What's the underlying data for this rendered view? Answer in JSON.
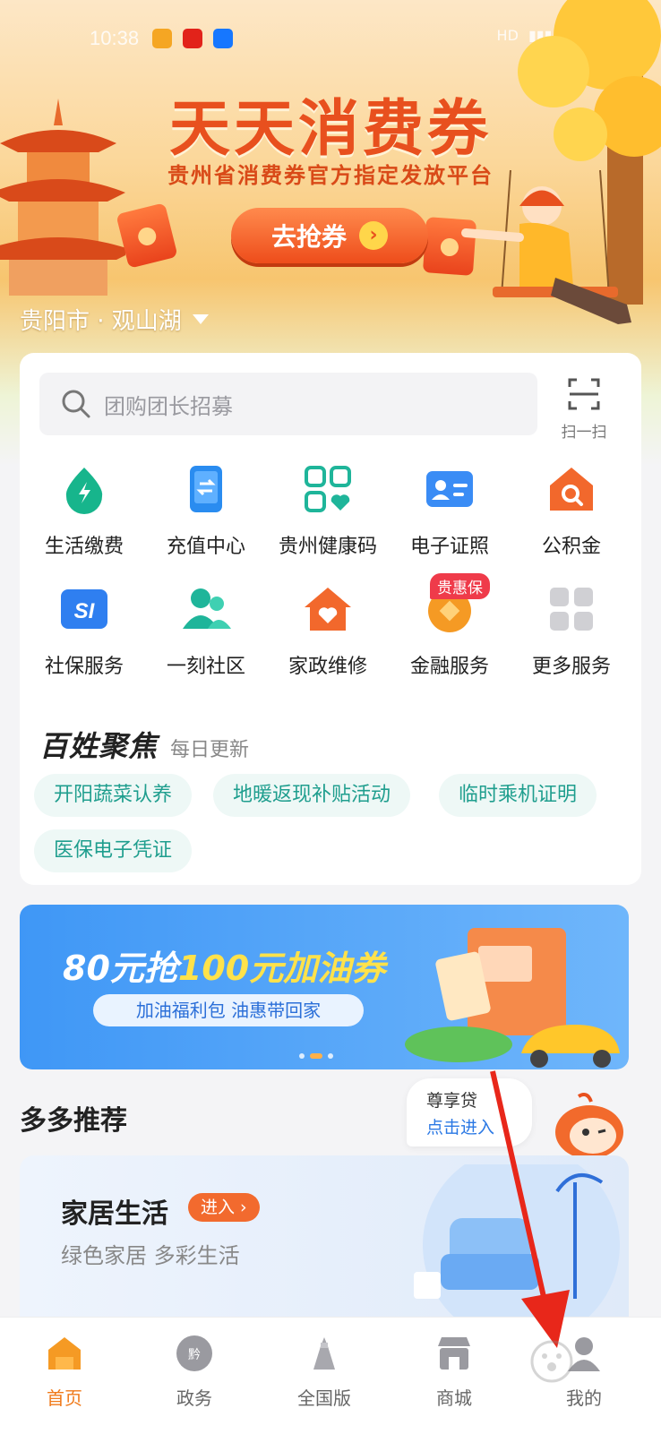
{
  "status_bar": {
    "time": "10:38",
    "network": "HD",
    "battery": "88"
  },
  "hero": {
    "title": "天天消费券",
    "subtitle": "贵州省消费券官方指定发放平台",
    "cta_label": "去抢券",
    "location": "贵阳市 · 观山湖"
  },
  "search": {
    "placeholder": "团购团长招募",
    "scan_label": "扫一扫"
  },
  "services": [
    {
      "label": "生活缴费",
      "icon": "bolt-drop-icon",
      "color": "#17b58c"
    },
    {
      "label": "充值中心",
      "icon": "phone-recharge-icon",
      "color": "#2a8cf0"
    },
    {
      "label": "贵州健康码",
      "icon": "health-code-icon",
      "color": "#1fb59a"
    },
    {
      "label": "电子证照",
      "icon": "id-card-icon",
      "color": "#3a8cf5"
    },
    {
      "label": "公积金",
      "icon": "house-search-icon",
      "color": "#f2682c"
    },
    {
      "label": "社保服务",
      "icon": "social-security-icon",
      "color": "#2f7ff0"
    },
    {
      "label": "一刻社区",
      "icon": "community-people-icon",
      "color": "#1fb59a"
    },
    {
      "label": "家政维修",
      "icon": "home-heart-icon",
      "color": "#f2682c"
    },
    {
      "label": "金融服务",
      "icon": "coin-icon",
      "color": "#f59a24",
      "badge": "贵惠保"
    },
    {
      "label": "更多服务",
      "icon": "more-grid-icon",
      "color": "#c7c7cc"
    }
  ],
  "focus": {
    "title": "百姓聚焦",
    "subtitle": "每日更新",
    "chips": [
      "开阳蔬菜认养",
      "地暖返现补贴活动",
      "临时乘机证明",
      "医保电子凭证"
    ]
  },
  "banner": {
    "title_part1": "80元抢",
    "title_part2": "100元加油券",
    "pill": "加油福利包 油惠带回家",
    "slide_index": 2,
    "slide_count": 3
  },
  "recommend": {
    "title": "多多推荐",
    "loan_title": "尊享贷",
    "loan_action": "点击进入",
    "card_title": "家居生活",
    "card_enter": "进入 ›",
    "card_sub": "绿色家居 多彩生活"
  },
  "tabs": [
    {
      "label": "首页",
      "icon": "home-icon",
      "active": true
    },
    {
      "label": "政务",
      "icon": "gov-icon",
      "active": false
    },
    {
      "label": "全国版",
      "icon": "national-icon",
      "active": false
    },
    {
      "label": "商城",
      "icon": "shop-icon",
      "active": false
    },
    {
      "label": "我的",
      "icon": "profile-icon",
      "active": false
    }
  ],
  "colors": {
    "accent": "#f07a1a",
    "hero_title": "#e8501e",
    "chip_text": "#1f9e8e",
    "banner_blue": "#3f97f6"
  }
}
